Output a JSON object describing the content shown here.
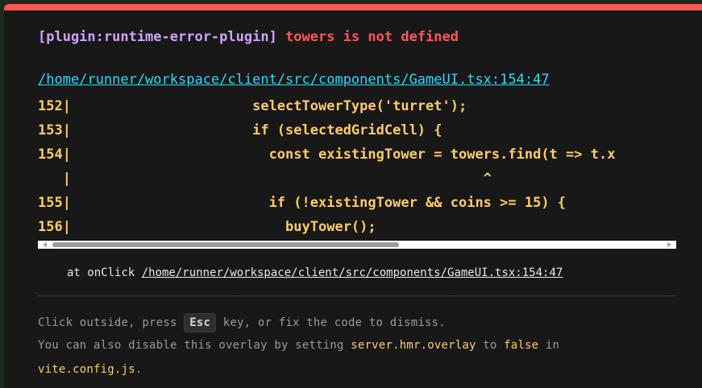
{
  "overlay": {
    "plugin": "[plugin:runtime-error-plugin]",
    "message": "towers is not defined",
    "file": "/home/runner/workspace/client/src/components/GameUI.tsx:154:47",
    "code_lines": [
      "152|                      selectTowerType('turret');",
      "153|                      if (selectedGridCell) {",
      "154|                        const existingTower = towers.find(t => t.x",
      "   |                                                  ^",
      "155|                        if (!existingTower && coins >= 15) {",
      "156|                          buyTower();"
    ],
    "stack_prefix": "at onClick ",
    "stack_link": "/home/runner/workspace/client/src/components/GameUI.tsx:154:47",
    "tip_line1_before": "Click outside, press ",
    "tip_key": "Esc",
    "tip_line1_after": " key, or fix the code to dismiss.",
    "tip_line2_before": "You can also disable this overlay by setting ",
    "tip_line2_setting": "server.hmr.overlay",
    "tip_line2_mid": " to ",
    "tip_line2_value": "false",
    "tip_line2_after": " in",
    "tip_line3_file": "vite.config.js",
    "tip_line3_after": "."
  },
  "colors": {
    "accent_red": "#ff5555",
    "plugin_purple": "#cfa4ff",
    "link_cyan": "#2dd9fe",
    "code_yellow": "#ffcb6b",
    "background": "#181818"
  }
}
